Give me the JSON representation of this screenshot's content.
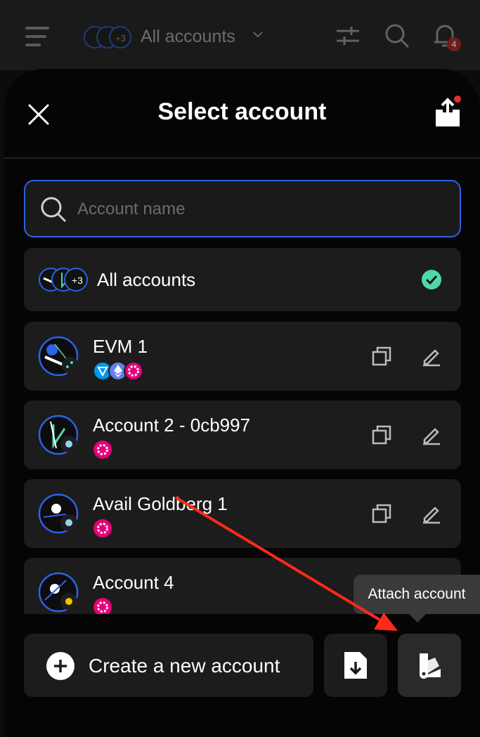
{
  "topbar": {
    "title": "All accounts",
    "notification_count": "4",
    "avatar_extra": "+3"
  },
  "modal": {
    "title": "Select account"
  },
  "search": {
    "placeholder": "Account name",
    "value": ""
  },
  "all_accounts": {
    "label": "All accounts",
    "extra_count": "+3",
    "selected": true
  },
  "accounts": [
    {
      "name": "EVM 1",
      "chains": [
        "ton-icon",
        "ethereum-icon",
        "polkadot-icon"
      ]
    },
    {
      "name": "Account 2 - 0cb997",
      "chains": [
        "polkadot-icon"
      ]
    },
    {
      "name": "Avail Goldberg 1",
      "chains": [
        "polkadot-icon"
      ]
    },
    {
      "name": "Account 4",
      "chains": [
        "polkadot-icon"
      ]
    }
  ],
  "footer": {
    "create_label": "Create a new account",
    "tooltip": "Attach account"
  },
  "colors": {
    "accent_blue": "#2c61e8",
    "check_green": "#4cd9ac",
    "polkadot_pink": "#e6007a",
    "annotation_red": "#ff2a1a"
  }
}
